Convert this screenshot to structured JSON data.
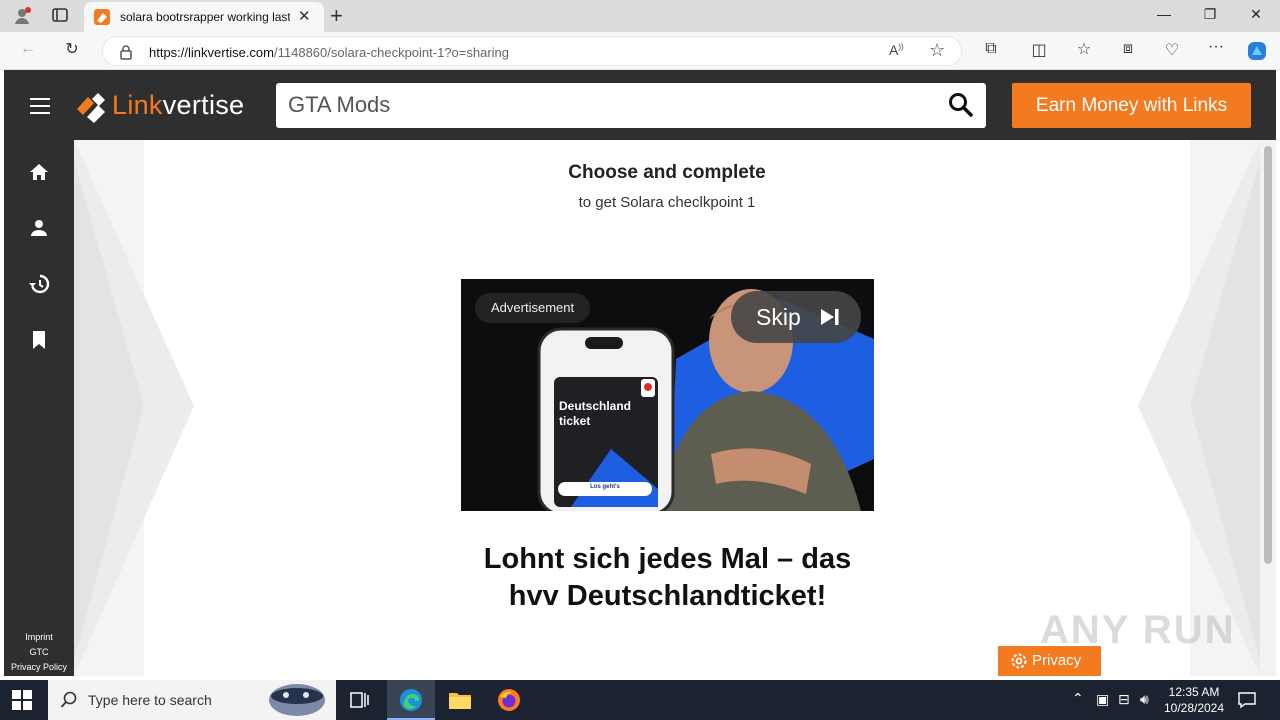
{
  "browser": {
    "tab_title": "solara bootrsrapper working last",
    "address": {
      "scheme_host": "https://linkvertise.com",
      "path": "/1148860/solara-checkpoint-1?o=sharing"
    }
  },
  "site": {
    "logo_text_orange": "Link",
    "logo_text_white": "vertise",
    "search_value": "GTA Mods",
    "earn_button": "Earn Money with Links",
    "footer": {
      "imprint": "Imprint",
      "gtc": "GTC",
      "privacy_policy": "Privacy Policy"
    }
  },
  "content": {
    "heading": "Choose and complete",
    "subheading": "to get Solara checlkpoint 1"
  },
  "ad": {
    "badge": "Advertisement",
    "skip": "Skip",
    "phone_title": "Deutschland ticket",
    "phone_button": "Los geht's",
    "headline": "Lohnt sich jedes Mal – das hvv Deutschlandticket!"
  },
  "privacy_button": "Privacy",
  "watermark": "ANY RUN",
  "taskbar": {
    "search_placeholder": "Type here to search",
    "time": "12:35 AM",
    "date": "10/28/2024"
  },
  "colors": {
    "brand_orange": "#f47a20",
    "header_dark": "#2f2f2f",
    "ad_blue": "#1d5fe0",
    "taskbar": "#1c2330"
  }
}
